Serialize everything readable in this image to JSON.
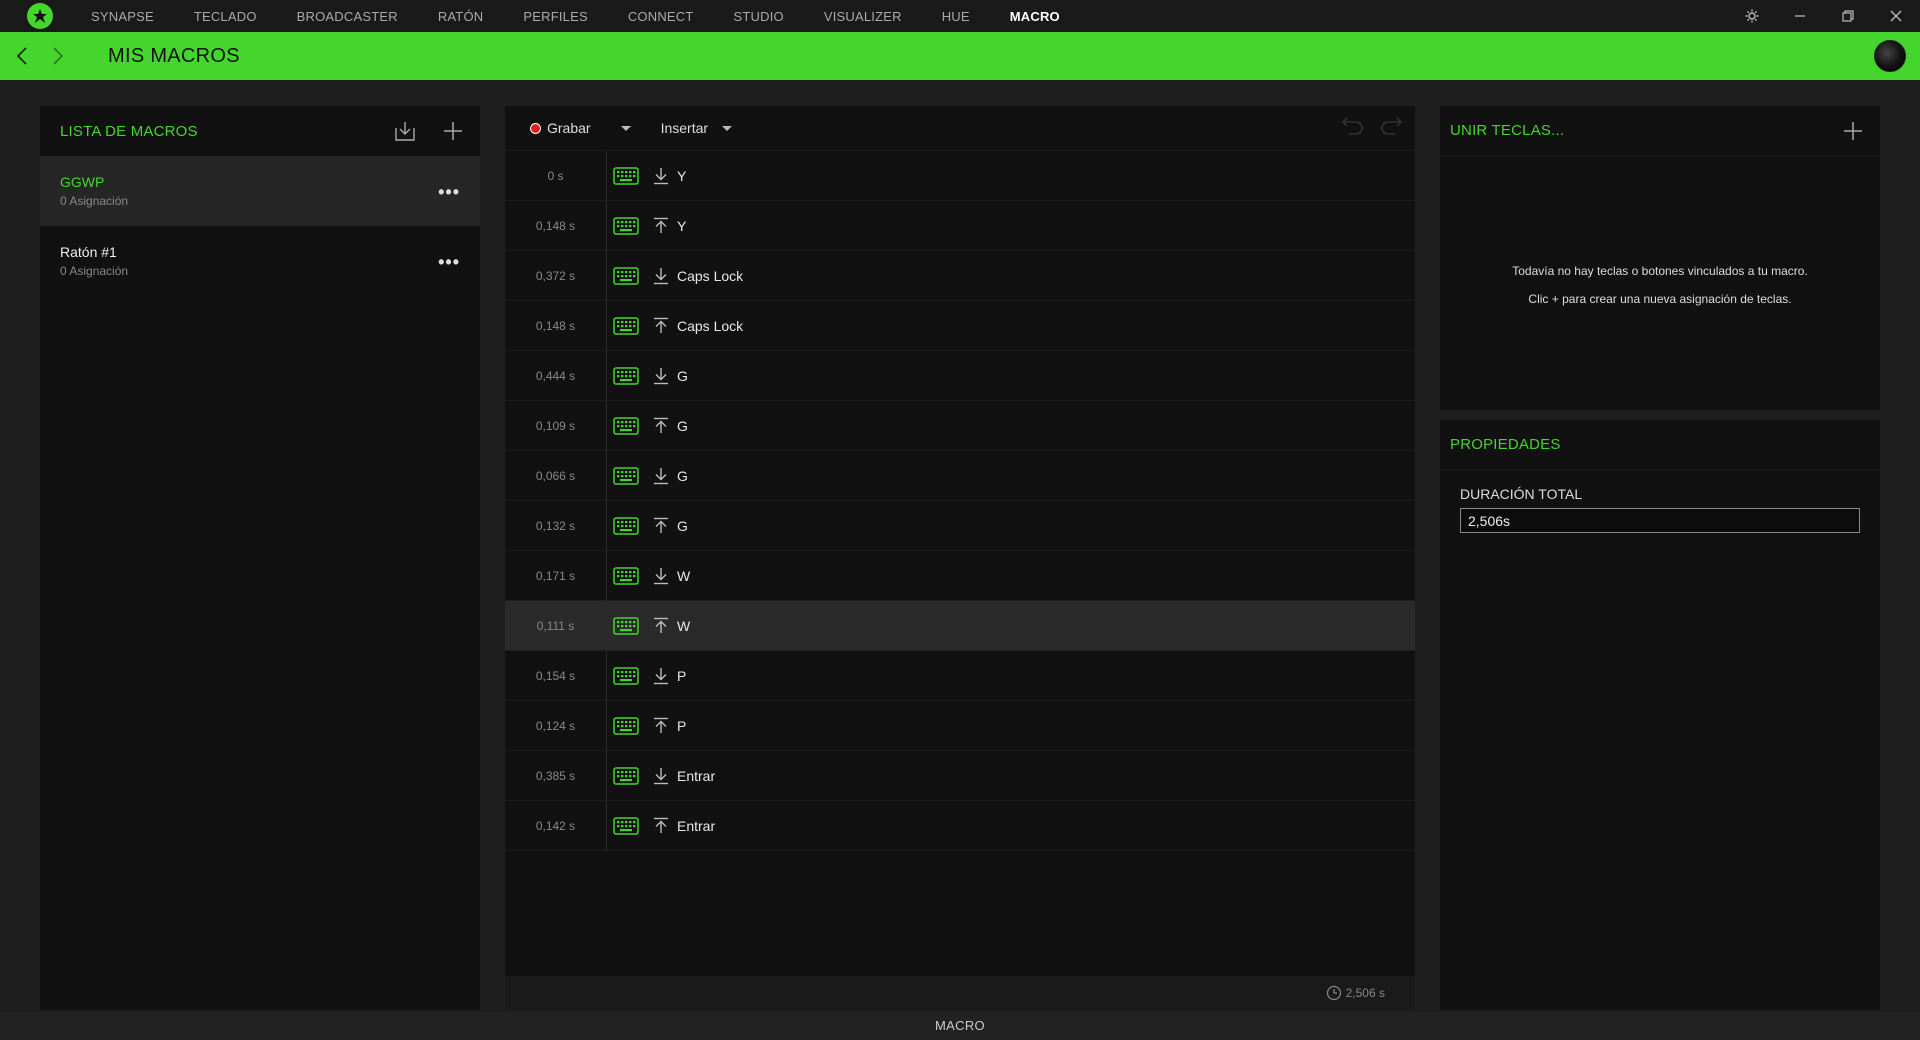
{
  "nav": {
    "items": [
      "SYNAPSE",
      "TECLADO",
      "BROADCASTER",
      "RATÓN",
      "PERFILES",
      "CONNECT",
      "STUDIO",
      "VISUALIZER",
      "HUE",
      "MACRO"
    ],
    "active": "MACRO"
  },
  "header": {
    "title": "MIS MACROS"
  },
  "macro_list": {
    "title": "LISTA DE MACROS",
    "items": [
      {
        "name": "GGWP",
        "sub": "0 Asignación",
        "selected": true
      },
      {
        "name": "Ratón #1",
        "sub": "0 Asignación",
        "selected": false
      }
    ]
  },
  "editor": {
    "record_label": "Grabar",
    "insert_label": "Insertar",
    "rows": [
      {
        "time": "0 s",
        "dir": "down",
        "key": "Y"
      },
      {
        "time": "0,148 s",
        "dir": "up",
        "key": "Y"
      },
      {
        "time": "0,372 s",
        "dir": "down",
        "key": "Caps Lock"
      },
      {
        "time": "0,148 s",
        "dir": "up",
        "key": "Caps Lock"
      },
      {
        "time": "0,444 s",
        "dir": "down",
        "key": "G"
      },
      {
        "time": "0,109 s",
        "dir": "up",
        "key": "G"
      },
      {
        "time": "0,066 s",
        "dir": "down",
        "key": "G"
      },
      {
        "time": "0,132 s",
        "dir": "up",
        "key": "G"
      },
      {
        "time": "0,171 s",
        "dir": "down",
        "key": "W"
      },
      {
        "time": "0,111 s",
        "dir": "up",
        "key": "W",
        "highlight": true
      },
      {
        "time": "0,154 s",
        "dir": "down",
        "key": "P"
      },
      {
        "time": "0,124 s",
        "dir": "up",
        "key": "P"
      },
      {
        "time": "0,385 s",
        "dir": "down",
        "key": "Entrar"
      },
      {
        "time": "0,142 s",
        "dir": "up",
        "key": "Entrar"
      }
    ],
    "total_time": "2,506 s"
  },
  "bind": {
    "title": "UNIR TECLAS...",
    "msg1": "Todavía no hay teclas o botones vinculados a tu macro.",
    "msg2": "Clic + para crear una nueva asignación de teclas."
  },
  "properties": {
    "title": "PROPIEDADES",
    "duration_label": "DURACIÓN TOTAL",
    "duration_value": "2,506s"
  },
  "statusbar": {
    "label": "MACRO"
  },
  "colors": {
    "accent": "#44d62c",
    "record": "#e0201f"
  }
}
